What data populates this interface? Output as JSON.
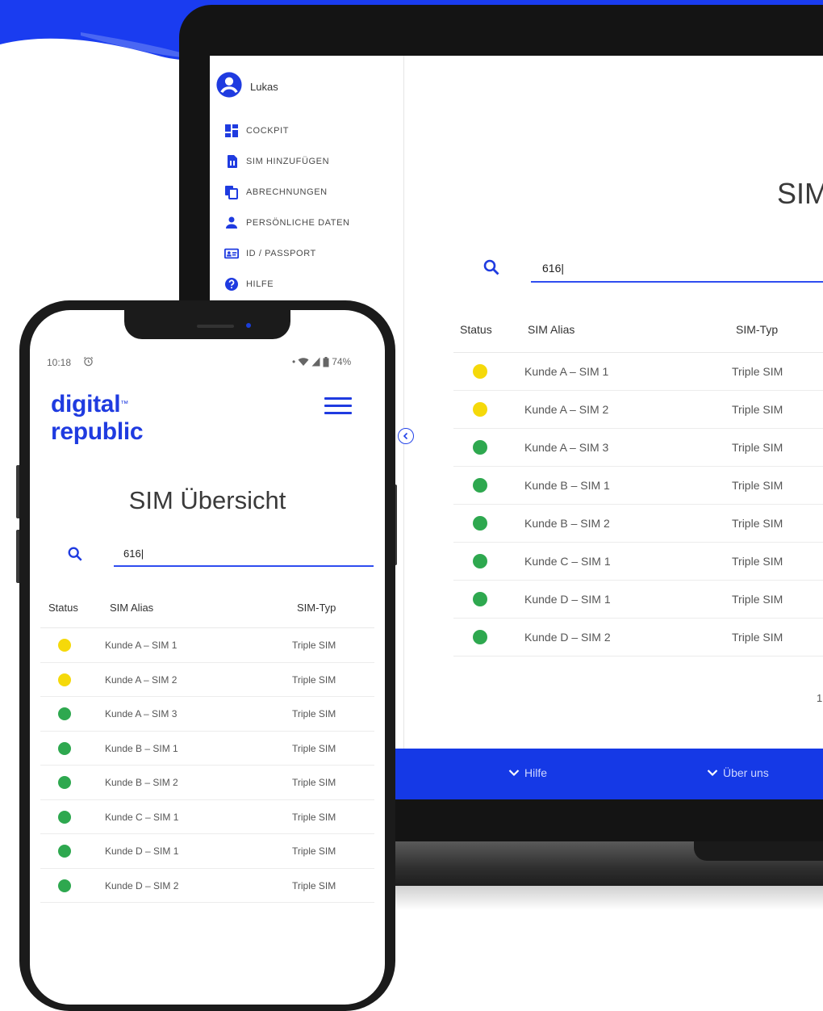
{
  "colors": {
    "brand_blue": "#1f3be0",
    "status_yellow": "#f5d90a",
    "status_green": "#2ea84f"
  },
  "laptop": {
    "user_name": "Lukas",
    "menu": [
      {
        "label": "COCKPIT",
        "icon": "dashboard-icon"
      },
      {
        "label": "SIM HINZUFÜGEN",
        "icon": "sim-card-icon"
      },
      {
        "label": "ABRECHNUNGEN",
        "icon": "copy-icon"
      },
      {
        "label": "PERSÖNLICHE DATEN",
        "icon": "person-icon"
      },
      {
        "label": "ID / PASSPORT",
        "icon": "id-card-icon"
      },
      {
        "label": "HILFE",
        "icon": "help-icon"
      }
    ],
    "title": "SIM Übersicht",
    "search_value": "616|",
    "columns": {
      "status": "Status",
      "alias": "SIM Alias",
      "typ": "SIM-Typ"
    },
    "rows": [
      {
        "status": "yellow",
        "alias": "Kunde A – SIM 1",
        "typ": "Triple SIM"
      },
      {
        "status": "yellow",
        "alias": "Kunde A – SIM 2",
        "typ": "Triple SIM"
      },
      {
        "status": "green",
        "alias": "Kunde A – SIM 3",
        "typ": "Triple SIM"
      },
      {
        "status": "green",
        "alias": "Kunde B – SIM 1",
        "typ": "Triple SIM"
      },
      {
        "status": "green",
        "alias": "Kunde B – SIM 2",
        "typ": "Triple SIM"
      },
      {
        "status": "green",
        "alias": "Kunde C – SIM 1",
        "typ": "Triple SIM"
      },
      {
        "status": "green",
        "alias": "Kunde D – SIM 1",
        "typ": "Triple SIM"
      },
      {
        "status": "green",
        "alias": "Kunde D – SIM 2",
        "typ": "Triple SIM"
      }
    ],
    "pagination": "1",
    "footer": {
      "help": "Hilfe",
      "about": "Über uns"
    }
  },
  "phone": {
    "time": "10:18",
    "battery": "74%",
    "logo_line1": "digital",
    "logo_tm": "™",
    "logo_line2": "republic",
    "title": "SIM Übersicht",
    "search_value": "616|",
    "columns": {
      "status": "Status",
      "alias": "SIM Alias",
      "typ": "SIM-Typ"
    },
    "rows": [
      {
        "status": "yellow",
        "alias": "Kunde A – SIM 1",
        "typ": "Triple SIM"
      },
      {
        "status": "yellow",
        "alias": "Kunde A – SIM 2",
        "typ": "Triple SIM"
      },
      {
        "status": "green",
        "alias": "Kunde A – SIM 3",
        "typ": "Triple SIM"
      },
      {
        "status": "green",
        "alias": "Kunde B – SIM 1",
        "typ": "Triple SIM"
      },
      {
        "status": "green",
        "alias": "Kunde B – SIM 2",
        "typ": "Triple SIM"
      },
      {
        "status": "green",
        "alias": "Kunde C – SIM 1",
        "typ": "Triple SIM"
      },
      {
        "status": "green",
        "alias": "Kunde D – SIM 1",
        "typ": "Triple SIM"
      },
      {
        "status": "green",
        "alias": "Kunde D – SIM 2",
        "typ": "Triple SIM"
      }
    ]
  }
}
